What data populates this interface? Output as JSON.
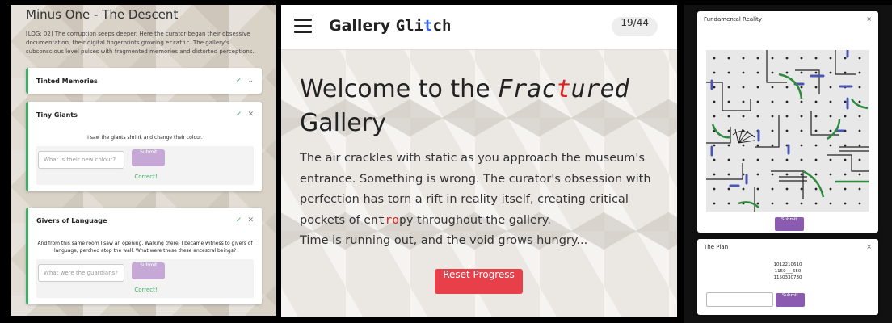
{
  "left_panel": {
    "title": "Minus One - The Descent",
    "log_pre": "[LOG: 02] The corruption seeps deeper. Here the curator began their obsessive documentation, their digital fingerprints growing ",
    "log_mono": "erratic",
    "log_post": ". The gallery's subconscious level pulses with fragmented memories and distorted perceptions.",
    "cards": [
      {
        "title": "Tinted Memories"
      },
      {
        "title": "Tiny Giants",
        "question": "I saw the giants shrink and change their colour.",
        "placeholder": "What is their new colour?",
        "submit": "Submit",
        "status": "Correct!"
      },
      {
        "title": "Givers of Language",
        "question": "And from this same room I saw an opening. Walking there, I became witness to givers of language, perched atop the wall. What were these these ancestral beings?",
        "placeholder": "What were the guardians?",
        "submit": "Submit",
        "status": "Correct!"
      }
    ]
  },
  "navbar": {
    "brand_1": "Gallery",
    "brand_2a": "Gli",
    "brand_2b": "t",
    "brand_2c": "ch",
    "counter": "19/44"
  },
  "hero": {
    "title_pre": "Welcome to the ",
    "title_fr1": "Frac",
    "title_fr2": "t",
    "title_fr3": "ured",
    "title_post": "Gallery",
    "para_1": "The air crackles with static as you approach the museum's entrance. Something is wrong. The curator's obsession with perfection has torn a rift in reality itself, creating critical pockets of ",
    "para_mono_a": "ent",
    "para_mono_b": "ro",
    "para_mono_c": "py",
    "para_2": " throughout the gallery.",
    "para_3": "Time is running out, and the void grows hungry...",
    "reset": "Reset Progress"
  },
  "right_panel": {
    "win1": {
      "title": "Fundamental Reality",
      "close": "×",
      "submit": "Submit"
    },
    "win2": {
      "title": "The Plan",
      "close": "×",
      "lines": [
        "1012210610",
        "1150___650",
        "1150330730"
      ],
      "submit": "Submit"
    }
  },
  "colors": {
    "accent_green": "#3cb064",
    "reset_red": "#e8404a",
    "purple": "#8a5bb0"
  }
}
